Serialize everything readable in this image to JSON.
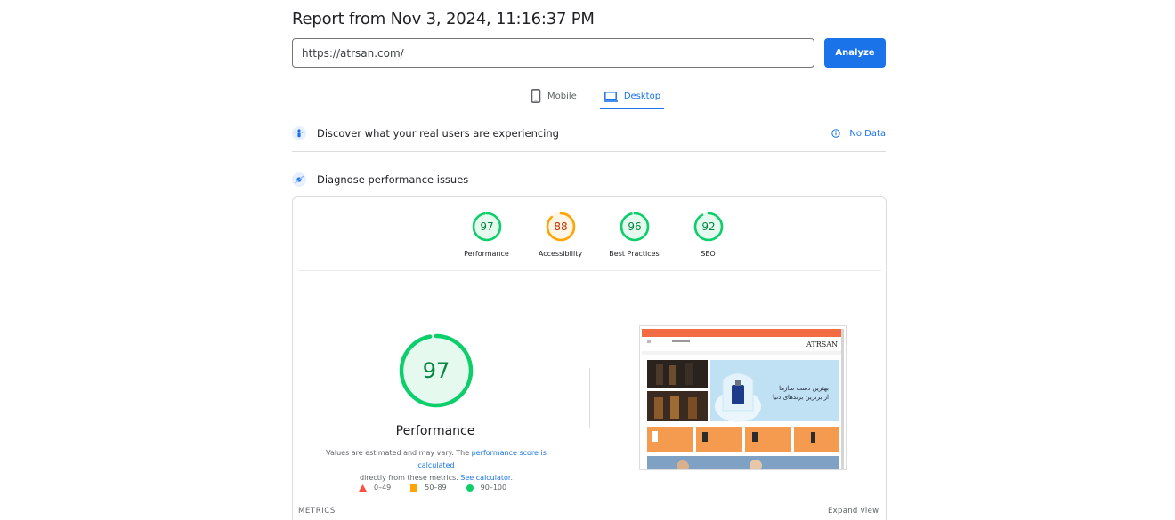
{
  "report": {
    "title": "Report from Nov 3, 2024, 11:16:37 PM"
  },
  "search": {
    "url": "https://atrsan.com/",
    "analyze_label": "Analyze"
  },
  "tabs": [
    {
      "label": "Mobile",
      "icon": "phone-icon",
      "active": false
    },
    {
      "label": "Desktop",
      "icon": "laptop-icon",
      "active": true
    }
  ],
  "crux": {
    "text": "Discover what your real users are experiencing",
    "status": "No Data"
  },
  "diagnose": {
    "text": "Diagnose performance issues"
  },
  "scores": [
    {
      "label": "Performance",
      "value": 97,
      "color": "#0cce6b",
      "text_color": "#018642",
      "bg": "#e6f9ee"
    },
    {
      "label": "Accessibility",
      "value": 88,
      "color": "#ffa400",
      "text_color": "#c33300",
      "bg": "#fff5e6"
    },
    {
      "label": "Best Practices",
      "value": 96,
      "color": "#0cce6b",
      "text_color": "#018642",
      "bg": "#e6f9ee"
    },
    {
      "label": "SEO",
      "value": 92,
      "color": "#0cce6b",
      "text_color": "#018642",
      "bg": "#e6f9ee"
    }
  ],
  "performance": {
    "title": "Performance",
    "value": 97,
    "note_prefix": "Values are estimated and may vary. The ",
    "note_link1": "performance score is calculated",
    "note_mid": " directly from these metrics. ",
    "note_link2": "See calculator",
    "note_suffix": "."
  },
  "legend": [
    {
      "range": "0–49",
      "shape": "triangle",
      "color": "#ff4e42"
    },
    {
      "range": "50–89",
      "shape": "square",
      "color": "#ffa400"
    },
    {
      "range": "90–100",
      "shape": "circle",
      "color": "#0cce6b"
    }
  ],
  "screenshot": {
    "logo_text": "ATRSAN",
    "banner_line1": "بهترین دست سازها",
    "banner_line2": "از برترین برندهای دنیا"
  },
  "metrics": {
    "label": "METRICS",
    "expand_label": "Expand view"
  }
}
